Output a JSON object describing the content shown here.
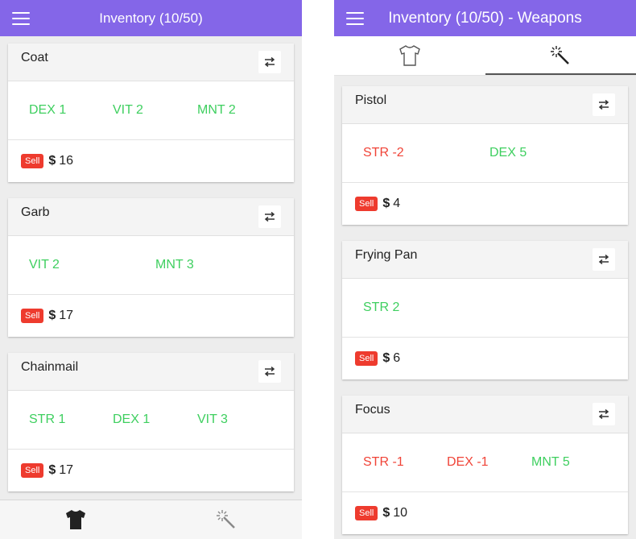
{
  "left": {
    "title": "Inventory (10/50)",
    "items": [
      {
        "name": "Coat",
        "stats": [
          {
            "text": "DEX 1",
            "sign": "pos"
          },
          {
            "text": "VIT 2",
            "sign": "pos"
          },
          {
            "text": "MNT 2",
            "sign": "pos"
          }
        ],
        "sell": "Sell",
        "price": "16"
      },
      {
        "name": "Garb",
        "stats": [
          {
            "text": "VIT 2",
            "sign": "pos"
          },
          {
            "text": "MNT 3",
            "sign": "pos"
          }
        ],
        "sell": "Sell",
        "price": "17"
      },
      {
        "name": "Chainmail",
        "stats": [
          {
            "text": "STR 1",
            "sign": "pos"
          },
          {
            "text": "DEX 1",
            "sign": "pos"
          },
          {
            "text": "VIT 3",
            "sign": "pos"
          }
        ],
        "sell": "Sell",
        "price": "17"
      }
    ],
    "bottom_tabs": [
      {
        "icon": "shirt-icon",
        "active": true
      },
      {
        "icon": "magic-wand-icon",
        "active": false
      }
    ]
  },
  "right": {
    "title": "Inventory (10/50) - Weapons",
    "tabs": [
      {
        "icon": "shirt-icon",
        "active": false
      },
      {
        "icon": "magic-wand-icon",
        "active": true
      }
    ],
    "items": [
      {
        "name": "Pistol",
        "stats": [
          {
            "text": "STR -2",
            "sign": "neg"
          },
          {
            "text": "DEX 5",
            "sign": "pos"
          }
        ],
        "sell": "Sell",
        "price": "4"
      },
      {
        "name": "Frying Pan",
        "stats": [
          {
            "text": "STR 2",
            "sign": "pos"
          }
        ],
        "sell": "Sell",
        "price": "6"
      },
      {
        "name": "Focus",
        "stats": [
          {
            "text": "STR -1",
            "sign": "neg"
          },
          {
            "text": "DEX -1",
            "sign": "neg"
          },
          {
            "text": "MNT 5",
            "sign": "pos"
          }
        ],
        "sell": "Sell",
        "price": "10"
      }
    ]
  },
  "currency_symbol": "$",
  "colors": {
    "header": "#8466e8",
    "positive": "#3ecf5f",
    "negative": "#f04438",
    "sell": "#ee3b2e"
  }
}
